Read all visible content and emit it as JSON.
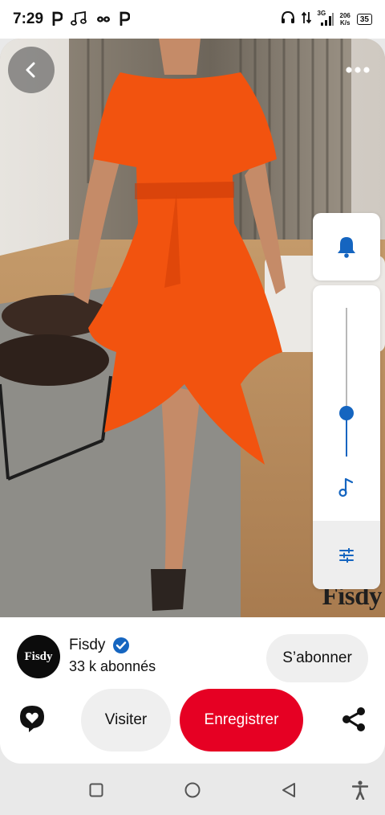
{
  "status_bar": {
    "time": "7:29",
    "left_icons": [
      "pinterest-notification-icon",
      "music-notification-icon",
      "infinity-notification-icon",
      "pinterest-notification-icon"
    ],
    "network_type": "3G",
    "speed_value": "206",
    "speed_unit": "K/s",
    "battery_level": "35"
  },
  "pin": {
    "watermark": "Fisdy",
    "dress_color": "#f2530f"
  },
  "side_controls": {
    "slider_level": 0.29,
    "accent_color": "#1565c0"
  },
  "creator": {
    "avatar_text": "Fisdy",
    "name": "Fisdy",
    "followers": "33 k abonnés",
    "verified": true
  },
  "actions": {
    "follow_label": "S’abonner",
    "visit_label": "Visiter",
    "save_label": "Enregistrer",
    "save_color": "#e60023"
  },
  "nav_bar": {
    "buttons": [
      "recents-square-icon",
      "home-circle-icon",
      "back-triangle-icon",
      "accessibility-icon"
    ]
  }
}
